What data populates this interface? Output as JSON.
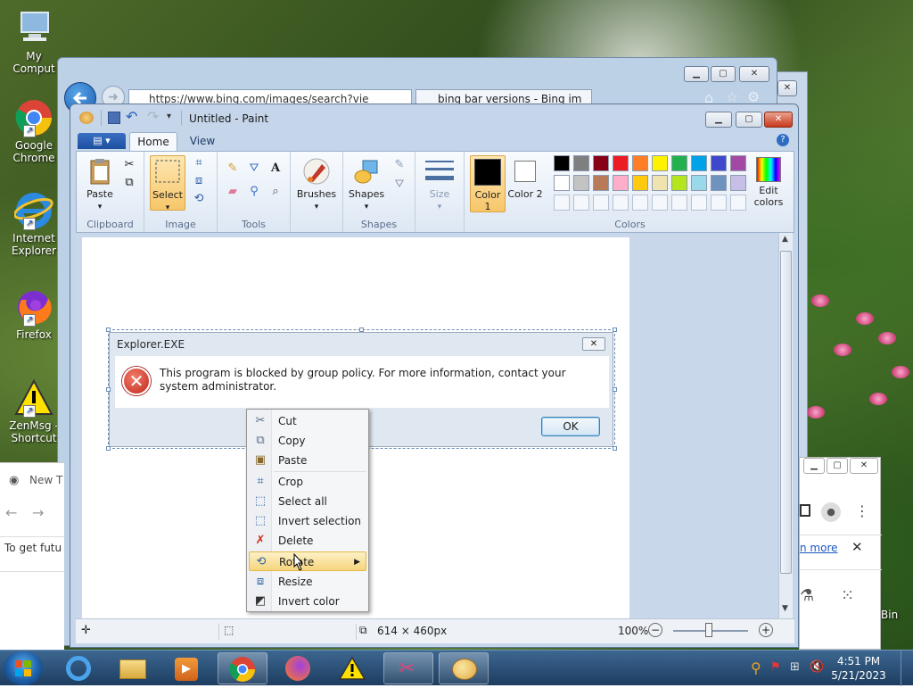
{
  "desktop": {
    "icons": [
      {
        "label": "My Comput",
        "name": "my-computer-icon"
      },
      {
        "label": "Google Chrome",
        "name": "chrome-icon"
      },
      {
        "label": "Internet Explorer",
        "name": "internet-explorer-icon"
      },
      {
        "label": "Firefox",
        "name": "firefox-icon"
      },
      {
        "label": "ZenMsg - Shortcut",
        "name": "warning-icon"
      }
    ],
    "corner_label": "Bin"
  },
  "ie": {
    "address": "https://www.bing.com/images/search?vie",
    "tab_title": "bing bar versions - Bing im"
  },
  "chrome": {
    "tab_title": "New T",
    "info_text": "To get futu",
    "learn_more": "n more"
  },
  "paint": {
    "title": "Untitled - Paint",
    "tabs": {
      "home": "Home",
      "view": "View"
    },
    "groups": {
      "clipboard": "Clipboard",
      "image": "Image",
      "tools": "Tools",
      "shapes": "Shapes",
      "colors": "Colors"
    },
    "buttons": {
      "paste": "Paste",
      "select": "Select",
      "brushes": "Brushes",
      "shapes": "Shapes",
      "size": "Size",
      "color1": "Color 1",
      "color2": "Color 2",
      "edit_colors": "Edit colors"
    },
    "palette_row1": [
      "#000000",
      "#7f7f7f",
      "#880015",
      "#ed1c24",
      "#ff7f27",
      "#fff200",
      "#22b14c",
      "#00a2e8",
      "#3f48cc",
      "#a349a4"
    ],
    "palette_row2": [
      "#ffffff",
      "#c3c3c3",
      "#b97a57",
      "#ffaec9",
      "#ffc90e",
      "#efe4b0",
      "#b5e61d",
      "#99d9ea",
      "#7092be",
      "#c8bfe7"
    ],
    "status": {
      "size": "614 × 460px",
      "zoom": "100%"
    }
  },
  "dialog": {
    "title": "Explorer.EXE",
    "message": "This program is blocked by group policy. For more information, contact your system administrator.",
    "ok": "OK"
  },
  "context_menu": {
    "items": [
      {
        "label": "Cut",
        "icon": "scissors-icon"
      },
      {
        "label": "Copy",
        "icon": "copy-icon"
      },
      {
        "label": "Paste",
        "icon": "paste-icon"
      },
      {
        "label": "Crop",
        "icon": "crop-icon"
      },
      {
        "label": "Select all",
        "icon": "select-all-icon"
      },
      {
        "label": "Invert selection",
        "icon": "invert-selection-icon"
      },
      {
        "label": "Delete",
        "icon": "delete-icon"
      },
      {
        "label": "Rotate",
        "icon": "rotate-icon"
      },
      {
        "label": "Resize",
        "icon": "resize-icon"
      },
      {
        "label": "Invert color",
        "icon": "invert-color-icon"
      }
    ]
  },
  "taskbar": {
    "time": "4:51 PM",
    "date": "5/21/2023"
  }
}
